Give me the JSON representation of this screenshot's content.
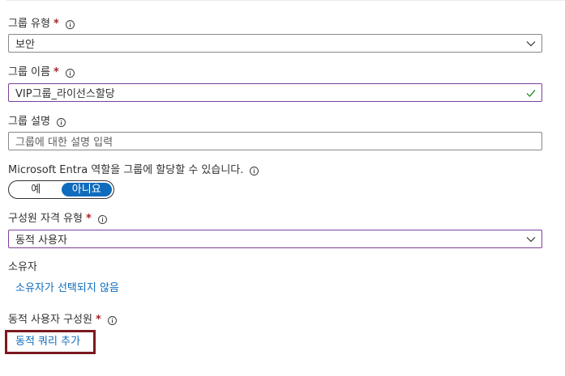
{
  "group_type": {
    "label": "그룹 유형",
    "value": "보안"
  },
  "group_name": {
    "label": "그룹 이름",
    "value": "VIP그룹_라이선스할당"
  },
  "group_description": {
    "label": "그룹 설명",
    "placeholder": "그룹에 대한 설명 입력"
  },
  "entra_roles": {
    "label": "Microsoft Entra 역할을 그룹에 할당할 수 있습니다.",
    "options": [
      "예",
      "아니요"
    ],
    "selected": "아니요"
  },
  "membership_type": {
    "label": "구성원 자격 유형",
    "value": "동적 사용자"
  },
  "owners": {
    "label": "소유자",
    "link_text": "소유자가 선택되지 않음"
  },
  "dynamic_members": {
    "label": "동적 사용자 구성원",
    "link_text": "동적 쿼리 추가"
  },
  "required_marker": "*",
  "colors": {
    "link": "#0f6cbd",
    "required": "#a4262c",
    "focus_border": "#7e3f9b",
    "valid_check": "#107c10",
    "highlight": "#7b1a1f"
  },
  "icons": {
    "info": "info-icon",
    "dropdown": "chevron-down-icon",
    "valid": "checkmark-icon"
  }
}
